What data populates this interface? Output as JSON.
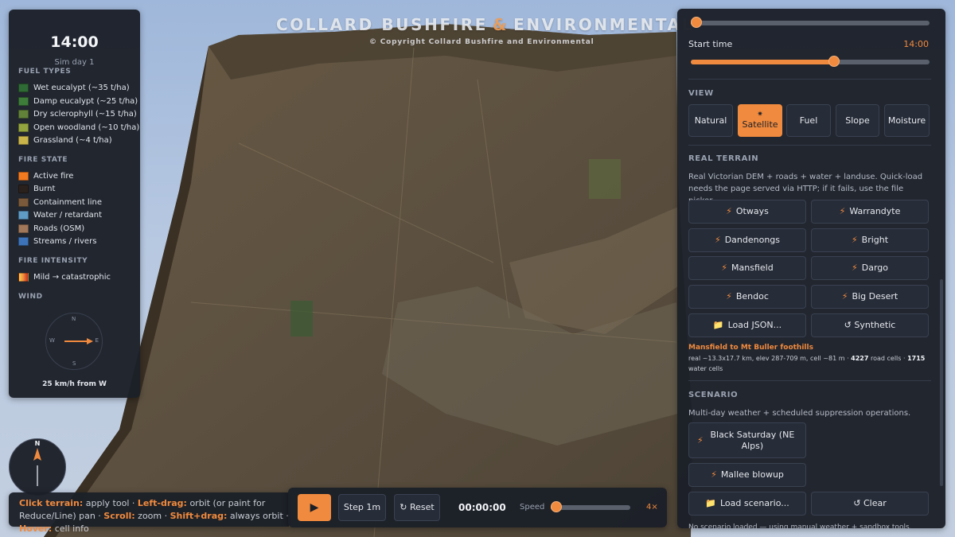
{
  "watermark": {
    "title_left": "COLLARD BUSHFIRE",
    "amp": "&",
    "title_right": "ENVIRONMENTAL",
    "copyright": "© Copyright Collard Bushfire and Environmental"
  },
  "legend": {
    "clock": "14:00",
    "sim_day": "Sim day 1",
    "fuel_types_heading": "FUEL TYPES",
    "fuel_types": [
      {
        "label": "Wet eucalypt (~35 t/ha)",
        "color": "#2f6b34"
      },
      {
        "label": "Damp eucalypt (~25 t/ha)",
        "color": "#3e7c3a"
      },
      {
        "label": "Dry sclerophyll (~15 t/ha)",
        "color": "#62823a"
      },
      {
        "label": "Open woodland (~10 t/ha)",
        "color": "#93a33e"
      },
      {
        "label": "Grassland (~4 t/ha)",
        "color": "#c9b54a"
      }
    ],
    "fire_state_heading": "FIRE STATE",
    "fire_state": [
      {
        "label": "Active fire",
        "color": "#f47a1f"
      },
      {
        "label": "Burnt",
        "color": "#2a211c"
      },
      {
        "label": "Containment line",
        "color": "#7a5a3a"
      },
      {
        "label": "Water / retardant",
        "color": "#5f9cc6"
      },
      {
        "label": "Roads (OSM)",
        "color": "#a1785a"
      },
      {
        "label": "Streams / rivers",
        "color": "#3d73b8"
      }
    ],
    "fire_intensity_heading": "FIRE INTENSITY",
    "fire_intensity_label": "Mild → catastrophic",
    "wind_heading": "WIND",
    "compass_points": {
      "n": "N",
      "e": "E",
      "s": "S",
      "w": "W"
    },
    "wind_speed": "25 km/h from W"
  },
  "north_compass": {
    "label": "N"
  },
  "help": {
    "k1": "Click terrain:",
    "t1": " apply tool · ",
    "k2": "Left-drag:",
    "t2": " orbit (or paint for Reduce/Line) pan · ",
    "k3": "Scroll:",
    "t3": " zoom · ",
    "k4": "Shift+drag:",
    "t4": " always orbit · ",
    "k5": "Hover:",
    "t5": " cell info"
  },
  "transport": {
    "play_icon": "▶",
    "step_label": "Step 1m",
    "reset_label": "↻ Reset",
    "timer": "00:00:00",
    "speed_label": "Speed",
    "speed_value": "4×",
    "speed_level": 0.07
  },
  "right_panel": {
    "top_slider_level": 0.02,
    "start_time_label": "Start time",
    "start_time_value": "14:00",
    "start_time_level": 0.6,
    "view_heading": "VIEW",
    "view_buttons": [
      "Natural",
      "Satellite",
      "Fuel",
      "Slope",
      "Moisture"
    ],
    "view_active": "Satellite",
    "satellite_icon": "satellite-icon",
    "real_terrain_heading": "REAL TERRAIN",
    "real_terrain_desc": "Real Victorian DEM + roads + water + landuse. Quick-load needs the page served via HTTP; if it fails, use the file picker.",
    "terrain_buttons": [
      "Otways",
      "Warrandyte",
      "Dandenongs",
      "Bright",
      "Mansfield",
      "Dargo",
      "Bendoc",
      "Big Desert"
    ],
    "load_json_label": "Load JSON...",
    "synthetic_label": "↺ Synthetic",
    "loaded_title": "Mansfield to Mt Buller foothills",
    "loaded_info_a": "real ~13.3x17.7 km, elev 287-709 m, cell ~81 m · ",
    "road_cells": "4227",
    "loaded_info_b": " road cells · ",
    "water_cells": "1715",
    "loaded_info_c": "water cells",
    "scenario_heading": "SCENARIO",
    "scenario_desc": "Multi-day weather + scheduled suppression operations.",
    "scenario_buttons": [
      "Black Saturday (NE Alps)",
      "Mallee blowup"
    ],
    "load_scenario_label": "Load scenario...",
    "clear_label": "↺ Clear",
    "scenario_status": "No scenario loaded — using manual weather + sandbox tools."
  },
  "colors": {
    "accent": "#f08a3e",
    "panel": "#1b1f28"
  }
}
